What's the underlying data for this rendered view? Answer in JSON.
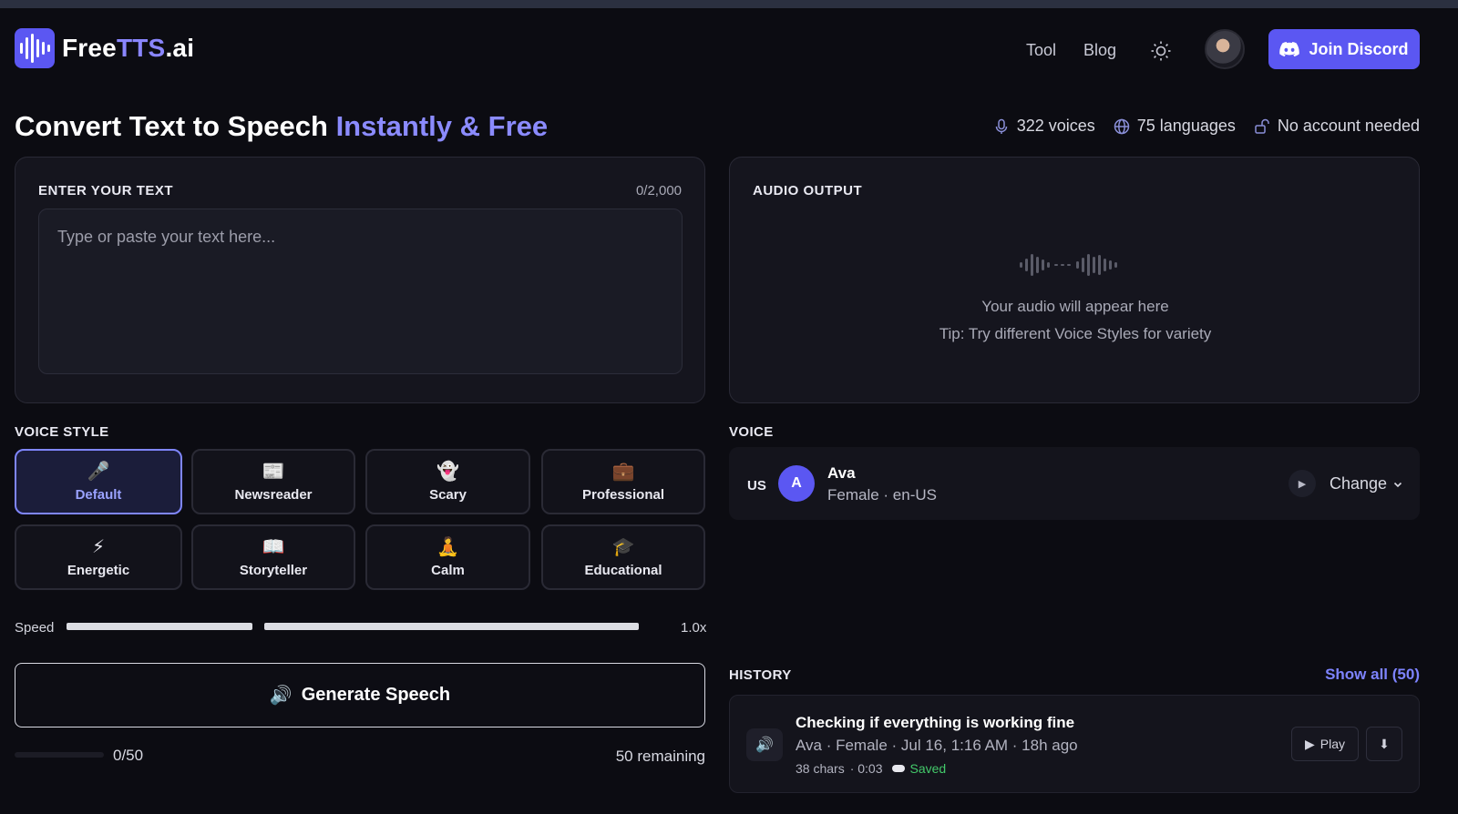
{
  "header": {
    "logo": {
      "part1": "Free",
      "part2": "TTS",
      "part3": ".ai"
    },
    "nav": {
      "tool": "Tool",
      "blog": "Blog"
    },
    "discord_label": "Join Discord",
    "brand_color": "#5b57f2"
  },
  "title": {
    "main": "Convert Text to Speech ",
    "highlight": "Instantly & Free"
  },
  "stats": {
    "voices": "322 voices",
    "languages": "75 languages",
    "account": "No account needed"
  },
  "input_panel": {
    "label": "ENTER YOUR TEXT",
    "count": "0/2,000",
    "placeholder": "Type or paste your text here..."
  },
  "audio_panel": {
    "label": "AUDIO OUTPUT",
    "message": "Your audio will appear here",
    "tip": "Tip: Try different Voice Styles for variety"
  },
  "voice_style": {
    "label": "VOICE STYLE",
    "styles": [
      {
        "label": "Default",
        "icon": "🎤",
        "active": true
      },
      {
        "label": "Newsreader",
        "icon": "📰"
      },
      {
        "label": "Scary",
        "icon": "👻"
      },
      {
        "label": "Professional",
        "icon": "💼"
      },
      {
        "label": "Energetic",
        "icon": "⚡"
      },
      {
        "label": "Storyteller",
        "icon": "📖"
      },
      {
        "label": "Calm",
        "icon": "🧘"
      },
      {
        "label": "Educational",
        "icon": "🎓"
      }
    ]
  },
  "speed": {
    "label": "Speed",
    "value": "1.0x"
  },
  "generate": {
    "label": "Generate Speech",
    "icon": "🔊"
  },
  "usage": {
    "count": "0/50",
    "remaining": "50 remaining"
  },
  "voice": {
    "label": "VOICE",
    "country": "US",
    "initial": "A",
    "name": "Ava",
    "meta": "Female · en-US",
    "change": "Change"
  },
  "history": {
    "label": "HISTORY",
    "show_all": "Show all (50)",
    "items": [
      {
        "title": "Checking if everything is working fine",
        "meta": "Ava · Female · Jul 16, 1:16 AM · 18h ago",
        "chars": "38 chars",
        "duration": "· 0:03",
        "status": "Saved",
        "play": "Play"
      }
    ]
  }
}
